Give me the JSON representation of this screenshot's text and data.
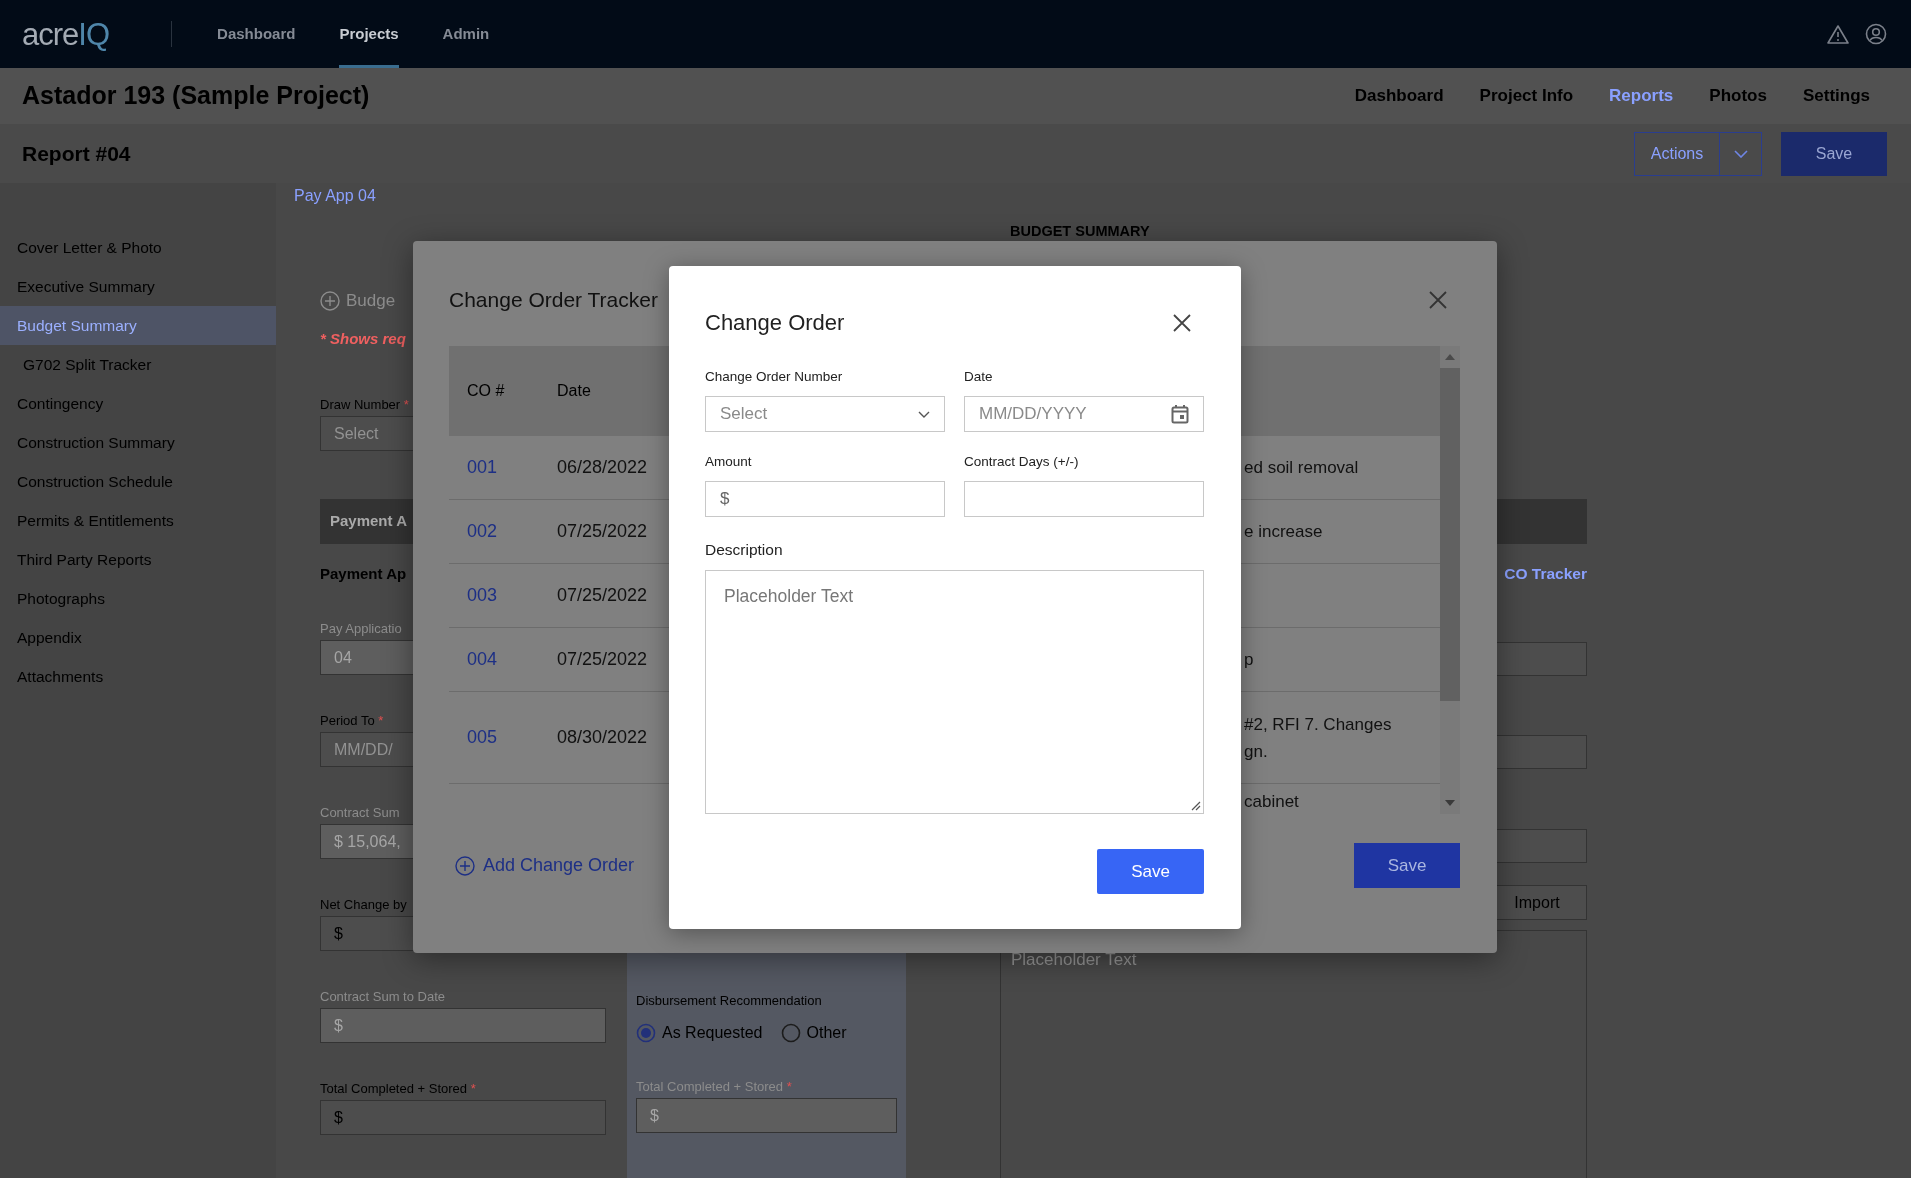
{
  "top_nav": {
    "logo_main": "acre",
    "logo_accent": "IQ",
    "items": [
      {
        "label": "Dashboard",
        "selected": false
      },
      {
        "label": "Projects",
        "selected": true
      },
      {
        "label": "Admin",
        "selected": false
      }
    ]
  },
  "project_bar": {
    "title": "Astador 193 (Sample Project)",
    "tabs": [
      {
        "label": "Dashboard",
        "selected": false
      },
      {
        "label": "Project Info",
        "selected": false
      },
      {
        "label": "Reports",
        "selected": true
      },
      {
        "label": "Photos",
        "selected": false
      },
      {
        "label": "Settings",
        "selected": false
      }
    ]
  },
  "report_bar": {
    "title": "Report #04",
    "actions": "Actions",
    "save": "Save"
  },
  "sidebar": {
    "items": [
      {
        "label": "Cover Letter & Photo",
        "selected": false
      },
      {
        "label": "Executive Summary",
        "selected": false
      },
      {
        "label": "Budget Summary",
        "selected": true,
        "children": [
          {
            "label": "G702 Split Tracker",
            "selected": false
          }
        ]
      },
      {
        "label": "Contingency",
        "selected": false
      },
      {
        "label": "Construction Summary",
        "selected": false
      },
      {
        "label": "Construction Schedule",
        "selected": false
      },
      {
        "label": "Permits & Entitlements",
        "selected": false
      },
      {
        "label": "Third Party Reports",
        "selected": false
      },
      {
        "label": "Photographs",
        "selected": false
      },
      {
        "label": "Appendix",
        "selected": false
      },
      {
        "label": "Attachments",
        "selected": false
      }
    ]
  },
  "report_form": {
    "breadcrumb": "Pay App 04",
    "section_toggle": "Budge",
    "required_note": "* Shows req",
    "top_fields": [
      {
        "label": "Draw Number",
        "required_mark": "*",
        "placeholder": "Select"
      }
    ],
    "band_title": "Payment A",
    "subheading": "Payment Ap",
    "fields": [
      {
        "label": "Pay Applicatio",
        "disabled": true,
        "value": "04"
      },
      {
        "label": "Period To",
        "required_mark": "*",
        "disabled": false,
        "placeholder": "MM/DD/"
      },
      {
        "label": "Contract Sum",
        "disabled": true,
        "prefix": "$",
        "value": "15,064,"
      },
      {
        "label": "Net Change by",
        "disabled": false,
        "prefix": "$"
      },
      {
        "label": "Contract Sum to Date",
        "disabled": true,
        "prefix": "$"
      },
      {
        "label": "Total Completed + Stored",
        "required_mark": "*",
        "disabled": false,
        "prefix": "$"
      }
    ],
    "disbursement": {
      "label": "Disbursement Recommendation",
      "options": [
        {
          "label": "As Requested",
          "selected": true
        },
        {
          "label": "Other",
          "selected": false
        }
      ]
    },
    "col2_fields": [
      {
        "label": "Total Completed + Stored",
        "required_mark": "*",
        "disabled": true,
        "prefix": "$"
      }
    ],
    "summary": {
      "title": "BUDGET SUMMARY",
      "co_link": "CO Tracker",
      "import": "Import",
      "notes_placeholder": "Placeholder Text"
    }
  },
  "tracker": {
    "title": "Change Order Tracker",
    "columns": [
      "CO #",
      "Date"
    ],
    "rows": [
      {
        "co": "001",
        "date": "06/28/2022",
        "description": [
          "ed soil removal"
        ]
      },
      {
        "co": "002",
        "date": "07/25/2022",
        "description": [
          "e increase"
        ]
      },
      {
        "co": "003",
        "date": "07/25/2022"
      },
      {
        "co": "004",
        "date": "07/25/2022",
        "description": [
          "p"
        ]
      },
      {
        "co": "005",
        "date": "08/30/2022",
        "description": [
          "#2, RFI 7. Changes",
          "gn."
        ]
      },
      {
        "description": [
          "cabinet"
        ]
      }
    ],
    "add_label": "Add Change Order",
    "save": "Save"
  },
  "dialog": {
    "title": "Change Order",
    "fields": [
      {
        "kind": "select",
        "label": "Change Order Number",
        "placeholder": "Select"
      },
      {
        "kind": "date",
        "label": "Date",
        "placeholder": "MM/DD/YYYY"
      },
      {
        "kind": "money",
        "label": "Amount",
        "prefix": "$"
      },
      {
        "kind": "text",
        "label": "Contract Days (+/-)"
      }
    ],
    "description": {
      "label": "Description",
      "placeholder": "Placeholder Text"
    },
    "save": "Save"
  }
}
